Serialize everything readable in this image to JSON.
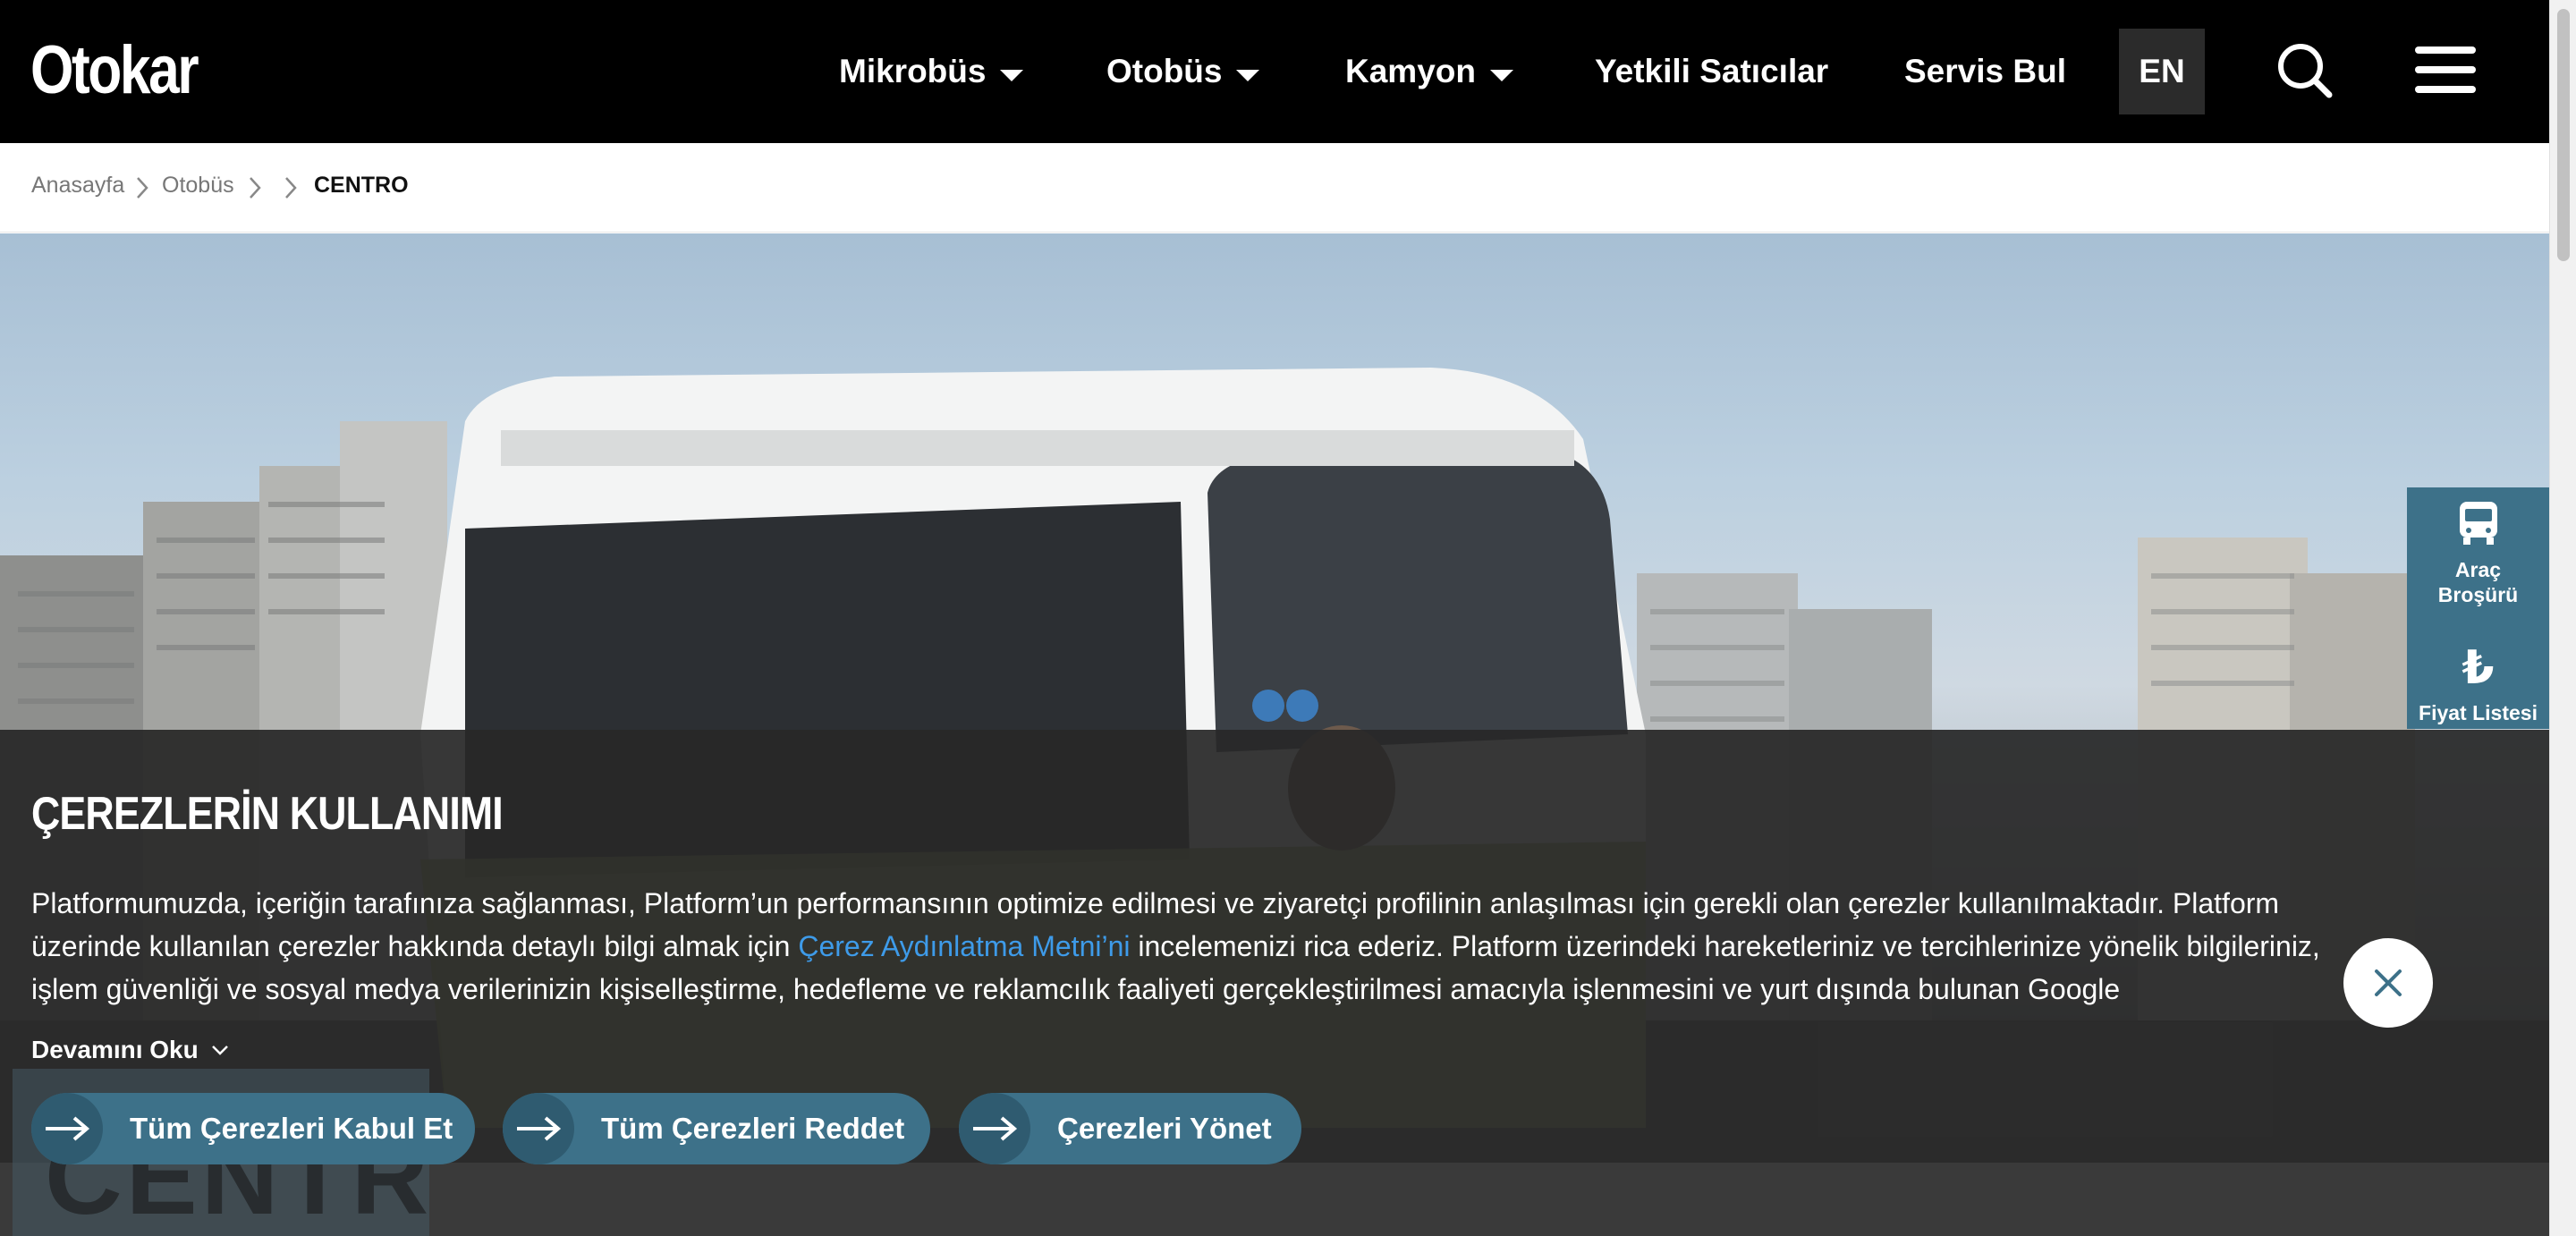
{
  "header": {
    "logo": "Otokar",
    "nav": [
      {
        "label": "Mikrobüs",
        "has_dropdown": true
      },
      {
        "label": "Otobüs",
        "has_dropdown": true
      },
      {
        "label": "Kamyon",
        "has_dropdown": true
      },
      {
        "label": "Yetkili Satıcılar",
        "has_dropdown": false
      },
      {
        "label": "Servis Bul",
        "has_dropdown": false
      }
    ],
    "language": "EN",
    "icons": {
      "search": "search-icon",
      "menu": "hamburger-menu-icon"
    }
  },
  "breadcrumb": {
    "items": [
      "Anasayfa",
      "Otobüs",
      "CENTRO"
    ]
  },
  "side_tabs": {
    "brochure": "Araç Broşürü",
    "price_list": "Fiyat Listesi"
  },
  "hero": {
    "badge_text": "CENTRO"
  },
  "cookie": {
    "title": "ÇEREZLERİN KULLANIMI",
    "text_before_link": "Platformumuzda, içeriğin tarafınıza sağlanması, Platform’un performansının optimize edilmesi ve ziyaretçi profilinin anlaşılması için gerekli olan çerezler kullanılmaktadır. Platform üzerinde kullanılan çerezler hakkında detaylı bilgi almak için ",
    "link_text": "Çerez Aydınlatma Metni’ni",
    "text_after_link": " incelemenizi rica ederiz. Platform üzerindeki hareketleriniz ve tercihlerinize yönelik bilgileriniz, işlem güvenliği ve sosyal medya verilerinizin kişiselleştirme, hedefleme ve reklamcılık faaliyeti gerçekleştirilmesi amacıyla işlenmesini ve yurt dışında bulunan Google",
    "read_more": "Devamını Oku",
    "buttons": {
      "accept_all": "Tüm Çerezleri Kabul Et",
      "reject_all": "Tüm Çerezleri Reddet",
      "manage": "Çerezleri Yönet"
    }
  },
  "colors": {
    "header_bg": "#000000",
    "accent": "#3d7189",
    "link": "#3e9be9",
    "banner_bg": "#282828"
  }
}
